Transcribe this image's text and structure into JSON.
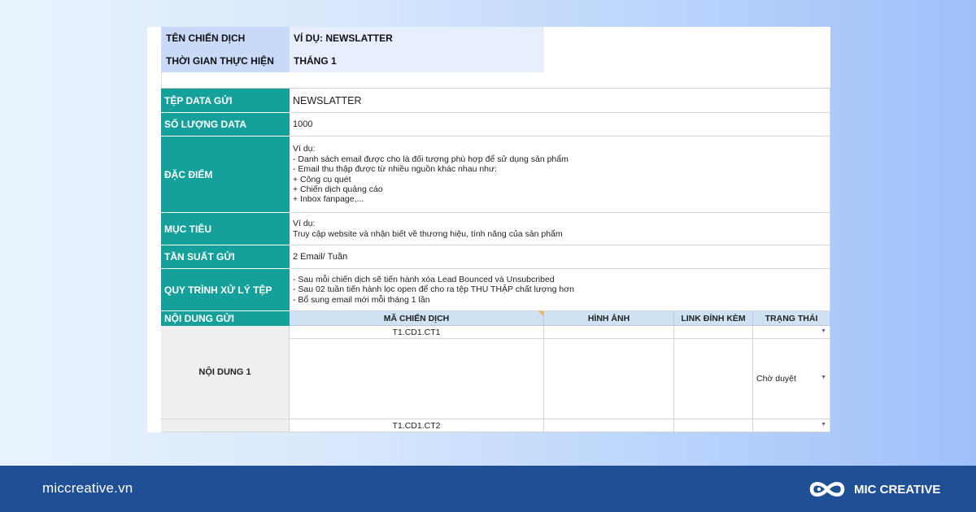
{
  "campaign": {
    "name_label": "TÊN CHIẾN DỊCH",
    "name_value": "VÍ DỤ: NEWSLATTER",
    "time_label": "THỜI GIAN THỰC HIỆN",
    "time_value": "THÁNG 1"
  },
  "rows": {
    "data_file": {
      "label": "TỆP DATA GỬI",
      "value": "NEWSLATTER"
    },
    "data_count": {
      "label": "SỐ LƯỢNG DATA",
      "value": "1000"
    },
    "features": {
      "label": "ĐẶC ĐIỂM",
      "lines": [
        "Ví dụ:",
        "- Danh sách email được cho là đối tượng phù hợp để sử dụng sản phẩm",
        "- Email thu thập được từ nhiều nguồn khác nhau như:",
        "+ Công cụ quét",
        "+ Chiến dịch quảng cáo",
        "+ Inbox fanpage,..."
      ]
    },
    "goal": {
      "label": "MỤC TIÊU",
      "lines": [
        "Ví dụ:",
        "Truy cập website và nhận biết về thương hiệu, tính năng của sản phẩm"
      ]
    },
    "frequency": {
      "label": "TẦN SUẤT GỬI",
      "value": "2 Email/ Tuần"
    },
    "process": {
      "label": "QUY TRÌNH XỬ LÝ TỆP",
      "lines": [
        "- Sau mỗi chiến dịch sẽ tiến hành xóa Lead Bounced và Unsubcribed",
        "- Sau 02 tuần tiến hành lọc open để cho ra tệp THU THẬP chất lượng hơn",
        "- Bổ sung email mới mỗi tháng 1 lần"
      ]
    }
  },
  "content_table": {
    "section_label": "NỘI DUNG GỬI",
    "columns": [
      "MÃ CHIẾN DỊCH",
      "HÌNH ẢNH",
      "LINK ĐÍNH KÈM",
      "TRẠNG THÁI"
    ],
    "items": [
      {
        "label": "NỘI DUNG 1",
        "code": "T1.CD1.CT1",
        "status": "Chờ duyệt"
      },
      {
        "label": "",
        "code": "T1.CD1.CT2",
        "status": ""
      }
    ]
  },
  "footer": {
    "site": "miccreative.vn",
    "brand": "MIC CREATIVE"
  },
  "colors": {
    "teal": "#16a09b",
    "header_blue": "#c9daf8",
    "footer_blue": "#1f4f95"
  }
}
